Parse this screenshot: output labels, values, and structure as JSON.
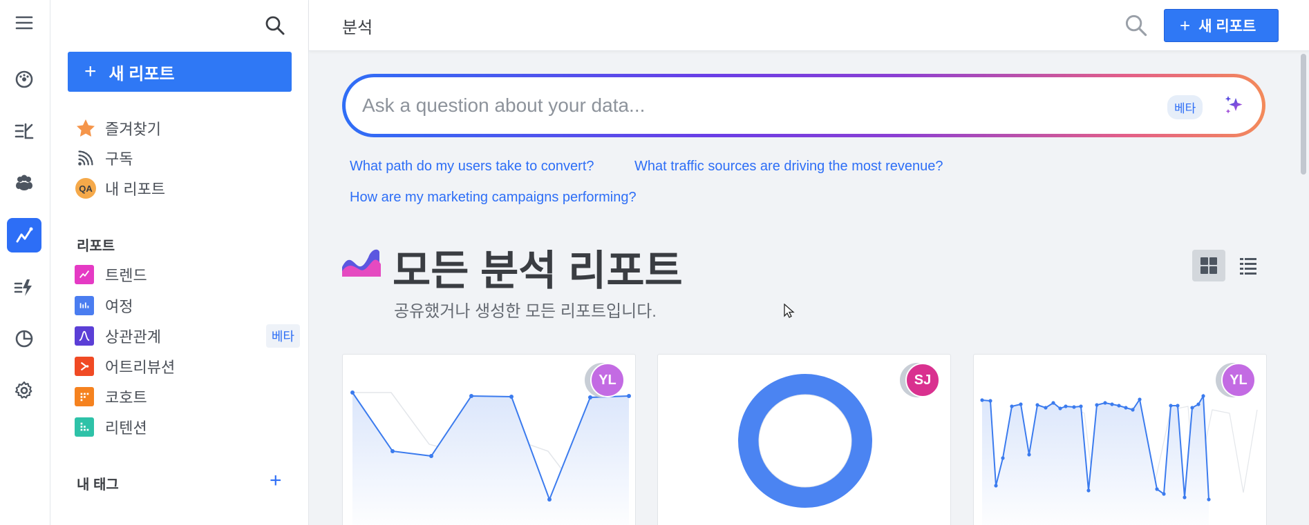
{
  "colors": {
    "accent": "#2f78f5",
    "rail_active": "#2d6ef6",
    "chart_line": "#3b7bee",
    "avatar_yl": "#c36be3",
    "avatar_sj": "#d9318f"
  },
  "rail": {
    "items": [
      "menu-icon",
      "dashboard-icon",
      "tasks-icon",
      "users-icon",
      "analytics-icon",
      "actions-icon",
      "pie-chart-icon",
      "gear-icon"
    ],
    "active": "analytics-icon"
  },
  "sidebar": {
    "new_report_label": "새 리포트",
    "links": [
      {
        "label": "즐겨찾기",
        "icon": "star-icon"
      },
      {
        "label": "구독",
        "icon": "subscription-icon"
      },
      {
        "label": "내 리포트",
        "icon": "qa-avatar",
        "avatar_text": "QA"
      }
    ],
    "reports_heading": "리포트",
    "reports": [
      {
        "label": "트렌드",
        "icon": "trend-icon",
        "color": "#e53ac4"
      },
      {
        "label": "여정",
        "icon": "journey-icon",
        "color": "#4a7df0"
      },
      {
        "label": "상관관계",
        "icon": "correlation-icon",
        "color": "#5b3fd6",
        "badge": "베타"
      },
      {
        "label": "어트리뷰션",
        "icon": "attribution-icon",
        "color": "#f04a24"
      },
      {
        "label": "코호트",
        "icon": "cohort-icon",
        "color": "#f5821f"
      },
      {
        "label": "리텐션",
        "icon": "retention-icon",
        "color": "#2ec2a8"
      }
    ],
    "tags_heading": "내 태그"
  },
  "topbar": {
    "title": "분석",
    "new_report_label": "새 리포트"
  },
  "ask": {
    "placeholder": "Ask a question about your data...",
    "badge": "베타"
  },
  "suggestions": [
    "What path do my users take to convert?",
    "What traffic sources are driving the most revenue?",
    "How are my marketing campaigns performing?"
  ],
  "section": {
    "title": "모든 분석 리포트",
    "subtitle": "공유했거나 생성한 모든 리포트입니다."
  },
  "cards": [
    {
      "avatar": "YL",
      "chart": "line"
    },
    {
      "avatar": "SJ",
      "chart": "donut"
    },
    {
      "avatar": "YL",
      "chart": "line"
    }
  ]
}
